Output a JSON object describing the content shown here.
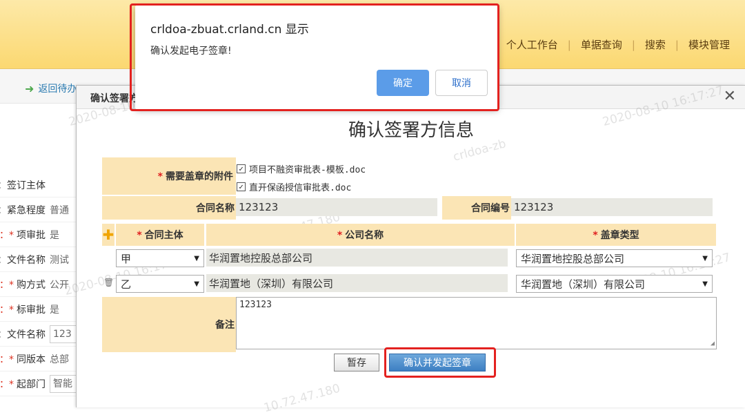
{
  "app": {
    "nav": [
      "个人工作台",
      "单据查询",
      "搜索",
      "模块管理"
    ],
    "back_label": "返回待办"
  },
  "bg_form": [
    {
      "label": "签订主体：",
      "required": false,
      "value": ""
    },
    {
      "label": "紧急程度：",
      "required": false,
      "value": "普通"
    },
    {
      "label": "项审批",
      "required": true,
      "value": "是"
    },
    {
      "label": "文件名称：",
      "required": false,
      "value": "测试"
    },
    {
      "label": "购方式",
      "required": true,
      "value": "公开"
    },
    {
      "label": "标审批",
      "required": true,
      "value": "是"
    },
    {
      "label": "文件名称：",
      "required": false,
      "value": "123"
    },
    {
      "label": "同版本",
      "required": true,
      "value": "总部"
    },
    {
      "label": "起部门",
      "required": true,
      "value": "智能"
    }
  ],
  "watermark": {
    "time": "2020-08-10 16:17:27",
    "ip": "10.72.47.180",
    "user": "crldoa-zb"
  },
  "dialog": {
    "title": "确认签署方",
    "heading": "确认签署方信息",
    "attachments_label": "需要盖章的附件",
    "attachments": [
      {
        "name": "项目不融资审批表-模板.doc",
        "checked": true
      },
      {
        "name": "直开保函授信审批表.doc",
        "checked": true
      }
    ],
    "contract_name_label": "合同名称",
    "contract_name": "123123",
    "contract_no_label": "合同编号",
    "contract_no": "123123",
    "columns": {
      "party": "合同主体",
      "company": "公司名称",
      "seal": "盖章类型"
    },
    "parties": [
      {
        "party": "甲",
        "company": "华润置地控股总部公司",
        "seal": "华润置地控股总部公司"
      },
      {
        "party": "乙",
        "company": "华润置地（深圳）有限公司",
        "seal": "华润置地（深圳）有限公司"
      }
    ],
    "remark_label": "备注",
    "remark": "123123",
    "save_label": "暂存",
    "confirm_label": "确认并发起签章"
  },
  "alert": {
    "title": "crldoa-zbuat.crland.cn 显示",
    "message": "确认发起电子签章!",
    "ok_label": "确定",
    "cancel_label": "取消"
  },
  "colors": {
    "highlight": "#e3211f",
    "label_bg": "#fbe5b5",
    "header_bg": "#fbd871",
    "primary": "#3d7fc2"
  }
}
